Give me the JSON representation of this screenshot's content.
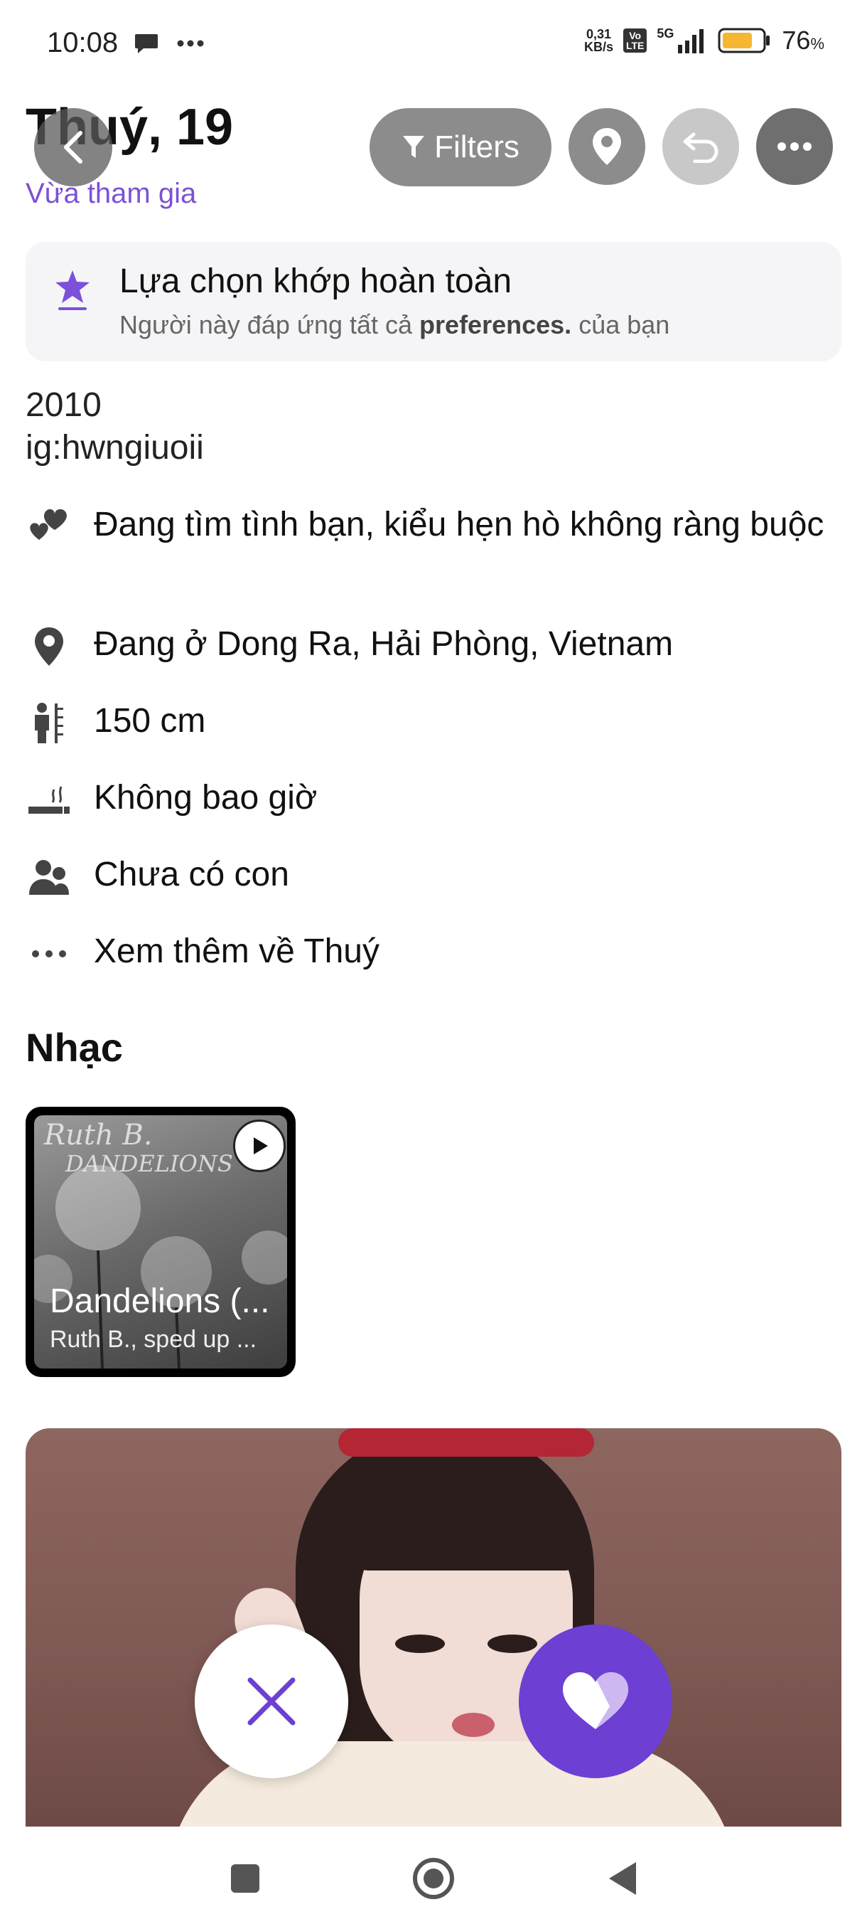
{
  "status_bar": {
    "time": "10:08",
    "net_speed_value": "0,31",
    "net_speed_unit": "KB/s",
    "volte_top": "Vo",
    "volte_bottom": "LTE",
    "network_type": "5G",
    "battery_percent": "76",
    "battery_symbol": "%",
    "battery_level": 0.76,
    "battery_color": "#f5b731"
  },
  "header": {
    "name_age": "Thuý, 19",
    "joined_label": "Vừa tham gia",
    "filters_label": "Filters",
    "accent_color": "#7c50d8"
  },
  "match_card": {
    "title": "Lựa chọn khớp hoàn toàn",
    "subtitle_prefix": "Người này đáp ứng tất cả",
    "subtitle_bold": "preferences.",
    "subtitle_suffix": "của bạn"
  },
  "bio": {
    "line1": "2010",
    "line2": "ig:hwngiuoii"
  },
  "attributes": [
    {
      "icon": "hearts-icon",
      "text": "Đang tìm tình bạn, kiểu hẹn hò không ràng buộc"
    },
    {
      "icon": "location-pin-icon",
      "text": "Đang ở Dong Ra, Hải Phòng, Vietnam"
    },
    {
      "icon": "height-icon",
      "text": "150 cm"
    },
    {
      "icon": "smoking-icon",
      "text": "Không bao giờ"
    },
    {
      "icon": "people-icon",
      "text": "Chưa có con"
    },
    {
      "icon": "more-dots-icon",
      "text": "Xem thêm về Thuý"
    }
  ],
  "music": {
    "section_title": "Nhạc",
    "art_line1": "Ruth B.",
    "art_line2": "DANDELIONS",
    "song_title": "Dandelions (...",
    "song_artist": "Ruth B., sped up ..."
  },
  "actions": {
    "dislike_color": "#6d3fd3",
    "like_color": "#6d3fd3"
  }
}
